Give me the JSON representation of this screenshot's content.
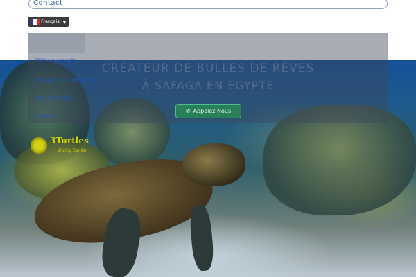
{
  "header": {
    "contact_link": "Contact",
    "language": {
      "label": "Français",
      "flag_colors": [
        "#1b3f9a",
        "#ffffff",
        "#d42b2b"
      ]
    }
  },
  "nav": {
    "items": [
      {
        "label": "Hébergements"
      },
      {
        "label": "Plongée & Formations"
      },
      {
        "label": "Nos Packages"
      },
      {
        "label": "Contact"
      }
    ]
  },
  "hero": {
    "title_line1": "CRÉATEUR DE BULLES DE RÊVES",
    "title_line2": "À SAFAGA EN ÉGYPTE",
    "call_button": "Appelez Nous",
    "call_icon": "phone-icon"
  },
  "logo": {
    "name": "3Turtles",
    "tagline": "Diving Center"
  },
  "colors": {
    "accent_green": "#2a7f5b",
    "nav_link": "#1d56b5",
    "logo_yellow": "#d6d10f"
  }
}
